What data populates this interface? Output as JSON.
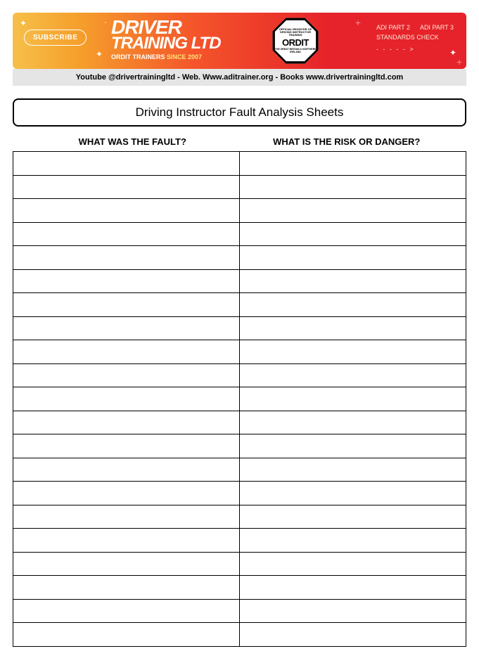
{
  "banner": {
    "subscribe_label": "SUBSCRIBE",
    "logo_line1": "DRIVER",
    "logo_line2": "TRAINING LTD",
    "since_prefix": "ORDIT TRAINERS ",
    "since_word": "SINCE ",
    "since_year": "2007",
    "ordit_top": "OFFICIAL REGISTER OF\nDRIVING INSTRUCTOR\nTRAINING",
    "ordit_main": "ORDIT",
    "ordit_bottom": "FOR GREAT BRITAIN &\nNORTHERN IRELAND",
    "right_items": [
      "ADI PART 2",
      "ADI PART 3",
      "STANDARDS CHECK"
    ],
    "arrow": "- - - - - >"
  },
  "infobar": "Youtube @drivertrainingltd - Web. Www.aditrainer.org  - Books www.drivertrainingltd.com",
  "title": "Driving Instructor Fault Analysis Sheets",
  "columns": {
    "left": "WHAT WAS THE FAULT?",
    "right": "WHAT IS THE RISK OR DANGER?"
  },
  "row_count": 21
}
